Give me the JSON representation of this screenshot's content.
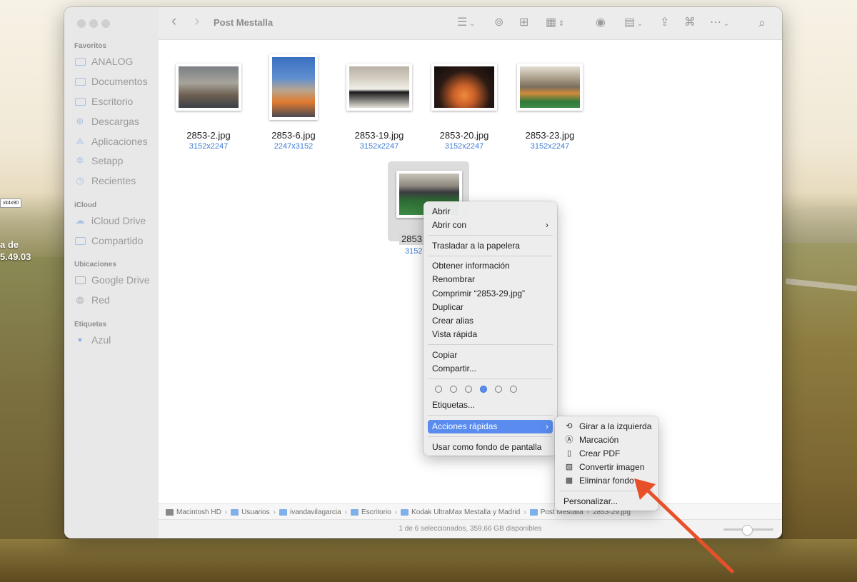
{
  "desktop": {
    "label": "vk4x90",
    "text_line1": "a de",
    "text_line2": "5.49.03"
  },
  "window": {
    "title": "Post Mestalla",
    "toolbar": {
      "back": "‹",
      "forward": "›",
      "list_icon": "☰",
      "airdrop_icon": "⊚",
      "new_folder_icon": "⊞",
      "view_icon": "▦",
      "eye_icon": "◉",
      "group_icon": "▤",
      "share_icon": "⇪",
      "tag_icon": "⌘",
      "more_icon": "⋯",
      "search_icon": "⌕"
    }
  },
  "sidebar": {
    "sections": {
      "favoritos": "Favoritos",
      "icloud": "iCloud",
      "ubicaciones": "Ubicaciones",
      "etiquetas": "Etiquetas"
    },
    "items": [
      {
        "label": "ANALOG",
        "icon": "▭"
      },
      {
        "label": "Documentos",
        "icon": "▭"
      },
      {
        "label": "Escritorio",
        "icon": "▭"
      },
      {
        "label": "Descargas",
        "icon": "⊕"
      },
      {
        "label": "Aplicaciones",
        "icon": "⟁"
      },
      {
        "label": "Setapp",
        "icon": "✲"
      },
      {
        "label": "Recientes",
        "icon": "◷"
      },
      {
        "label": "iCloud Drive",
        "icon": "☁"
      },
      {
        "label": "Compartido",
        "icon": "▭"
      },
      {
        "label": "Google Drive",
        "icon": "▭"
      },
      {
        "label": "Red",
        "icon": "◍"
      },
      {
        "label": "Azul",
        "icon": "●"
      }
    ]
  },
  "files": [
    {
      "name": "2853-2.jpg",
      "dims": "3152x2247"
    },
    {
      "name": "2853-6.jpg",
      "dims": "2247x3152"
    },
    {
      "name": "2853-19.jpg",
      "dims": "3152x2247"
    },
    {
      "name": "2853-20.jpg",
      "dims": "3152x2247"
    },
    {
      "name": "2853-23.jpg",
      "dims": "3152x2247"
    },
    {
      "name": "2853",
      "dims": "3152"
    }
  ],
  "context_menu": {
    "abrir": "Abrir",
    "abrir_con": "Abrir con",
    "papelera": "Trasladar a la papelera",
    "info": "Obtener información",
    "renombrar": "Renombrar",
    "comprimir": "Comprimir “2853-29.jpg”",
    "duplicar": "Duplicar",
    "alias": "Crear alias",
    "vista": "Vista rápida",
    "copiar": "Copiar",
    "compartir": "Compartir...",
    "etiquetas": "Etiquetas...",
    "acciones": "Acciones rápidas",
    "fondo": "Usar como fondo de pantalla",
    "submenu_arrow": "›"
  },
  "quick_actions": {
    "girar": "Girar a la izquierda",
    "marcacion": "Marcación",
    "pdf": "Crear PDF",
    "convertir": "Convertir imagen",
    "eliminar": "Eliminar fondo",
    "personalizar": "Personalizar..."
  },
  "pathbar": {
    "items": [
      "Macintosh HD",
      "Usuarios",
      "ivandavilagarcia",
      "Escritorio",
      "Kodak UltraMax Mestalla y Madrid",
      "Post Mestalla",
      "2853-29.jpg"
    ],
    "separator": "›"
  },
  "status": "1 de 6 seleccionados, 359,66 GB disponibles",
  "colors": {
    "accent": "#5a8cf0",
    "tag_blue": "#5a8cf0",
    "annotation_arrow": "#e8502a",
    "link_blue": "#3d7bd6"
  }
}
